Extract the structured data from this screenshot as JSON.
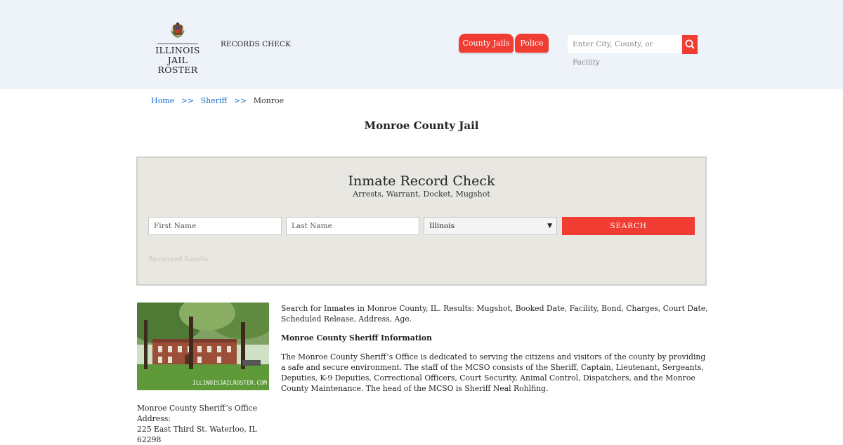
{
  "header": {
    "logo_line1": "ILLINOIS",
    "logo_line2": "JAIL ROSTER",
    "records_link": "RECORDS CHECK",
    "nav": [
      "County Jails",
      "Police"
    ],
    "search_placeholder": "Enter City, County, or Facility",
    "accent_color": "#f03c33"
  },
  "breadcrumb": {
    "home": "Home",
    "sep": ">>",
    "sheriff": "Sheriff",
    "current": "Monroe"
  },
  "page_title": "Monroe County Jail",
  "record_check": {
    "title": "Inmate Record Check",
    "subtitle": "Arrests, Warrant, Docket, Mugshot",
    "first_name_placeholder": "First Name",
    "last_name_placeholder": "Last Name",
    "state_selected": "Illinois",
    "search_label": "SEARCH",
    "sponsored": "Sponsored Results"
  },
  "content": {
    "photo_watermark": "ILLINOISJAILROSTER.COM",
    "intro": "Search for Inmates in Monroe County, IL. Results: Mugshot, Booked Date, Facility, Bond, Charges, Court Date, Scheduled Release, Address, Age.",
    "section_heading": "Monroe County Sheriff Information",
    "body": "The Monroe County Sheriff’s Office is dedicated to serving the citizens and visitors of the county by providing a safe and secure environment. The staff of the MCSO consists of the Sheriff, Captain, Lieutenant, Sergeants, Deputies, K-9 Deputies, Correctional Officers, Court Security, Animal Control, Dispatchers, and the Monroe County Maintenance. The head of the MCSO is Sheriff Neal Rohlfing.",
    "address_label": "Monroe County Sheriff’s Office Address:",
    "address": "225 East Third St. Waterloo, IL 62298"
  }
}
